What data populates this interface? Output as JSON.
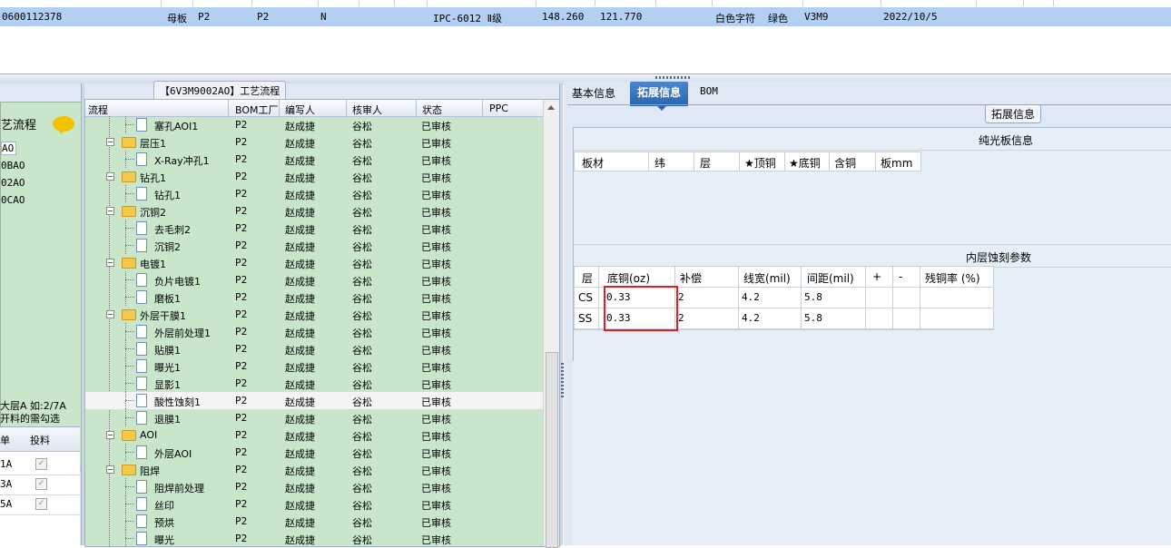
{
  "top_grid": {
    "row": {
      "id": "0600112378",
      "type": "母板",
      "c1": "P2",
      "c2": "P2",
      "c3": "N",
      "grade": "IPC-6012 Ⅱ级",
      "w": "148.260",
      "h": "121.770",
      "silk": "白色字符",
      "mask": "绿色",
      "code": "V3M9",
      "date": "2022/10/5"
    }
  },
  "left_panel": {
    "title": "艺流程",
    "items": [
      "AO",
      "0BAO",
      "02AO",
      "0CAO"
    ],
    "note_line1": "大层A 如:2/7A",
    "note_line2": "开料的需勾选",
    "grid_headers": [
      "单",
      "投料"
    ],
    "grid_rows": [
      "1A",
      "3A",
      "5A"
    ],
    "checkbox_mark": "✓"
  },
  "process_tree": {
    "caption": "【6V3M9002AO】工艺流程",
    "headers": [
      "流程",
      "BOM工厂",
      "编写人",
      "核审人",
      "状态",
      "PPC"
    ],
    "rows": [
      {
        "name": "塞孔AOI1",
        "level": 2,
        "icon": "doc",
        "bom": "P2",
        "writer": "赵成捷",
        "reviewer": "谷松",
        "status": "已审核"
      },
      {
        "name": "层压1",
        "level": 1,
        "icon": "folder",
        "bom": "P2",
        "writer": "赵成捷",
        "reviewer": "谷松",
        "status": "已审核"
      },
      {
        "name": "X-Ray冲孔1",
        "level": 2,
        "icon": "doc",
        "bom": "P2",
        "writer": "赵成捷",
        "reviewer": "谷松",
        "status": "已审核"
      },
      {
        "name": "钻孔1",
        "level": 1,
        "icon": "folder",
        "bom": "P2",
        "writer": "赵成捷",
        "reviewer": "谷松",
        "status": "已审核"
      },
      {
        "name": "钻孔1",
        "level": 2,
        "icon": "doc",
        "bom": "P2",
        "writer": "赵成捷",
        "reviewer": "谷松",
        "status": "已审核"
      },
      {
        "name": "沉铜2",
        "level": 1,
        "icon": "folder",
        "bom": "P2",
        "writer": "赵成捷",
        "reviewer": "谷松",
        "status": "已审核"
      },
      {
        "name": "去毛刺2",
        "level": 2,
        "icon": "doc",
        "bom": "P2",
        "writer": "赵成捷",
        "reviewer": "谷松",
        "status": "已审核"
      },
      {
        "name": "沉铜2",
        "level": 2,
        "icon": "doc",
        "bom": "P2",
        "writer": "赵成捷",
        "reviewer": "谷松",
        "status": "已审核"
      },
      {
        "name": "电镀1",
        "level": 1,
        "icon": "folder",
        "bom": "P2",
        "writer": "赵成捷",
        "reviewer": "谷松",
        "status": "已审核"
      },
      {
        "name": "负片电镀1",
        "level": 2,
        "icon": "doc",
        "bom": "P2",
        "writer": "赵成捷",
        "reviewer": "谷松",
        "status": "已审核"
      },
      {
        "name": "磨板1",
        "level": 2,
        "icon": "doc",
        "bom": "P2",
        "writer": "赵成捷",
        "reviewer": "谷松",
        "status": "已审核"
      },
      {
        "name": "外层干膜1",
        "level": 1,
        "icon": "folder",
        "bom": "P2",
        "writer": "赵成捷",
        "reviewer": "谷松",
        "status": "已审核"
      },
      {
        "name": "外层前处理1",
        "level": 2,
        "icon": "doc",
        "bom": "P2",
        "writer": "赵成捷",
        "reviewer": "谷松",
        "status": "已审核"
      },
      {
        "name": "贴膜1",
        "level": 2,
        "icon": "doc",
        "bom": "P2",
        "writer": "赵成捷",
        "reviewer": "谷松",
        "status": "已审核"
      },
      {
        "name": "曝光1",
        "level": 2,
        "icon": "doc",
        "bom": "P2",
        "writer": "赵成捷",
        "reviewer": "谷松",
        "status": "已审核"
      },
      {
        "name": "显影1",
        "level": 2,
        "icon": "doc",
        "bom": "P2",
        "writer": "赵成捷",
        "reviewer": "谷松",
        "status": "已审核"
      },
      {
        "name": "酸性蚀刻1",
        "level": 2,
        "icon": "doc",
        "bom": "P2",
        "writer": "赵成捷",
        "reviewer": "谷松",
        "status": "已审核",
        "selected": true
      },
      {
        "name": "退膜1",
        "level": 2,
        "icon": "doc",
        "bom": "P2",
        "writer": "赵成捷",
        "reviewer": "谷松",
        "status": "已审核"
      },
      {
        "name": "AOI",
        "level": 1,
        "icon": "folder",
        "bom": "P2",
        "writer": "赵成捷",
        "reviewer": "谷松",
        "status": "已审核"
      },
      {
        "name": "外层AOI",
        "level": 2,
        "icon": "doc",
        "bom": "P2",
        "writer": "赵成捷",
        "reviewer": "谷松",
        "status": "已审核"
      },
      {
        "name": "阻焊",
        "level": 1,
        "icon": "folder",
        "bom": "P2",
        "writer": "赵成捷",
        "reviewer": "谷松",
        "status": "已审核"
      },
      {
        "name": "阻焊前处理",
        "level": 2,
        "icon": "doc",
        "bom": "P2",
        "writer": "赵成捷",
        "reviewer": "谷松",
        "status": "已审核"
      },
      {
        "name": "丝印",
        "level": 2,
        "icon": "doc",
        "bom": "P2",
        "writer": "赵成捷",
        "reviewer": "谷松",
        "status": "已审核"
      },
      {
        "name": "预烘",
        "level": 2,
        "icon": "doc",
        "bom": "P2",
        "writer": "赵成捷",
        "reviewer": "谷松",
        "status": "已审核"
      },
      {
        "name": "曝光",
        "level": 2,
        "icon": "doc",
        "bom": "P2",
        "writer": "赵成捷",
        "reviewer": "谷松",
        "status": "已审核"
      }
    ]
  },
  "right_panel": {
    "tabs": [
      "基本信息",
      "拓展信息",
      "BOM"
    ],
    "active_tab": "拓展信息",
    "ext_button": "拓展信息",
    "section1_title": "纯光板信息",
    "section1_headers": [
      "板材",
      "纬",
      "层",
      "★顶铜",
      "★底铜",
      "含铜",
      "板mm"
    ],
    "section2_title": "内层蚀刻参数",
    "section2_headers": [
      "层",
      "底铜(oz)",
      "补偿",
      "线宽(mil)",
      "间距(mil)",
      "+",
      "-",
      "残铜率 (%)"
    ],
    "section2_rows": [
      {
        "layer": "CS",
        "base_cu": "0.33",
        "comp": "2",
        "line_w": "4.2",
        "space": "5.8",
        "plus": "",
        "minus": "",
        "residual": ""
      },
      {
        "layer": "SS",
        "base_cu": "0.33",
        "comp": "2",
        "line_w": "4.2",
        "space": "5.8",
        "plus": "",
        "minus": "",
        "residual": ""
      }
    ]
  },
  "colors": {
    "selected_row": "#b3cff4",
    "tree_bg": "#c9e6cb",
    "tab_active": "#2a64ad",
    "highlight_box": "#e02020",
    "folder": "#f4c84a"
  }
}
